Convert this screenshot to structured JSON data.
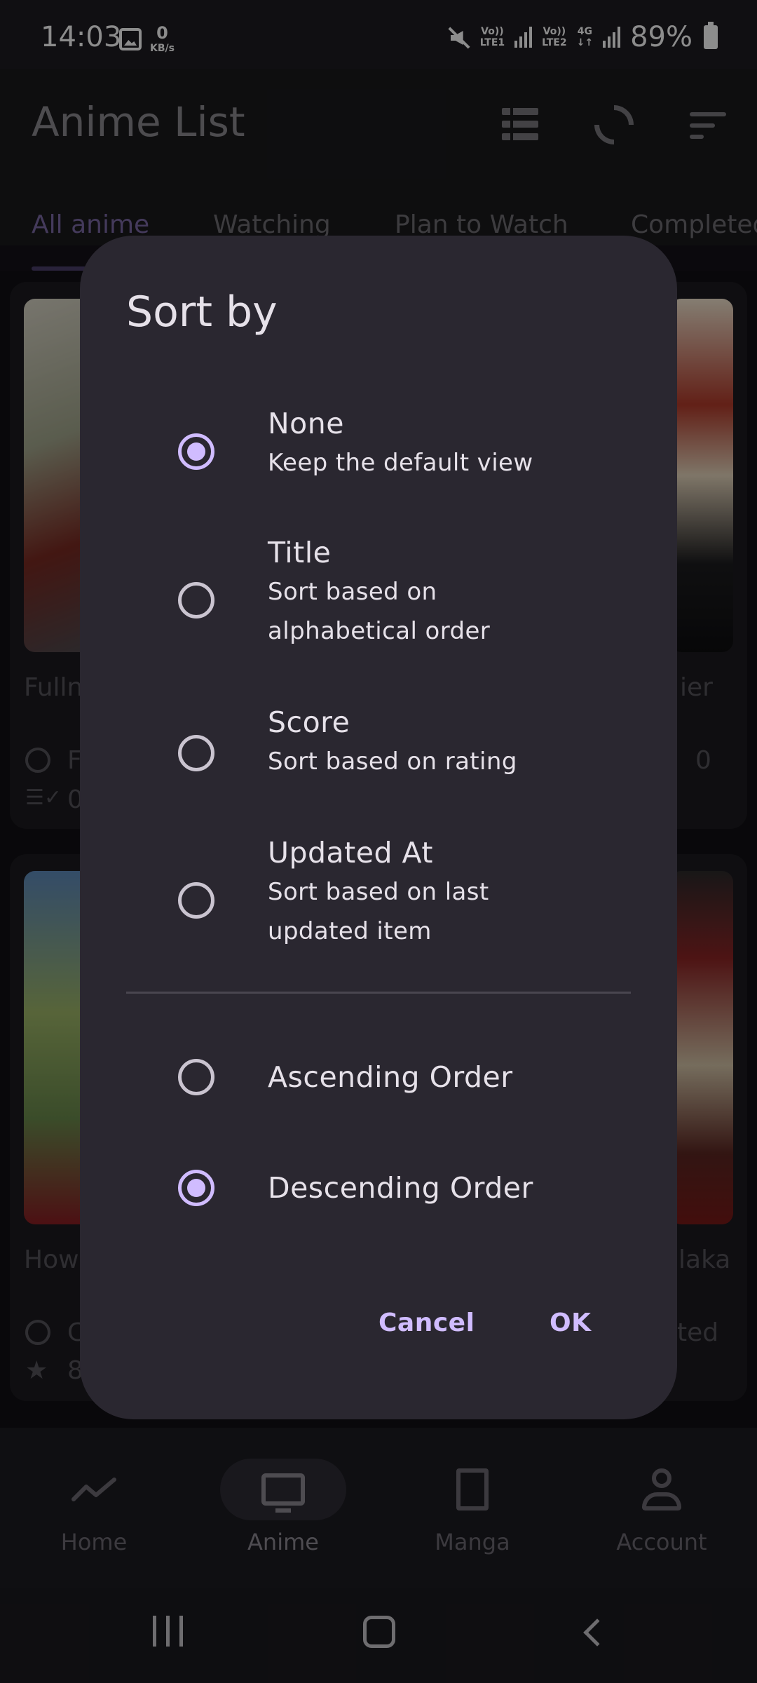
{
  "status_bar": {
    "time": "14:03",
    "speed_value": "0",
    "speed_unit": "KB/s",
    "sim1_top": "Vo))",
    "sim1_bottom": "LTE1",
    "sim2_top": "Vo))",
    "sim2_bottom": "LTE2",
    "network": "4G",
    "battery": "89%"
  },
  "app_bar": {
    "title": "Anime List"
  },
  "tabs": [
    {
      "label": "All anime",
      "active": true
    },
    {
      "label": "Watching"
    },
    {
      "label": "Plan to Watch"
    },
    {
      "label": "Completed"
    }
  ],
  "background_peek": {
    "card1_title": "Fulln",
    "card1_stat1": "F",
    "card1_stat2": "0",
    "card2_title": "ier",
    "card2_stat": "0",
    "card3_title": "How",
    "card3_stat1": "C",
    "card3_stat2": "8",
    "card4_title": "laka",
    "card4_stat": "ted"
  },
  "dialog": {
    "title": "Sort by",
    "sort_options": [
      {
        "title": "None",
        "subtitle": "Keep the default view",
        "checked": true
      },
      {
        "title": "Title",
        "subtitle": "Sort based on alphabetical order",
        "checked": false
      },
      {
        "title": "Score",
        "subtitle": "Sort based on rating",
        "checked": false
      },
      {
        "title": "Updated At",
        "subtitle": "Sort based on last updated item",
        "checked": false
      }
    ],
    "order_options": [
      {
        "label": "Ascending Order",
        "checked": false
      },
      {
        "label": "Descending Order",
        "checked": true
      }
    ],
    "cancel_label": "Cancel",
    "ok_label": "OK",
    "accent_color": "#d0bcff"
  },
  "bottom_nav": {
    "items": [
      {
        "label": "Home",
        "icon": "trending-icon"
      },
      {
        "label": "Anime",
        "icon": "tv-icon",
        "active": true
      },
      {
        "label": "Manga",
        "icon": "document-icon"
      },
      {
        "label": "Account",
        "icon": "person-icon"
      }
    ]
  }
}
